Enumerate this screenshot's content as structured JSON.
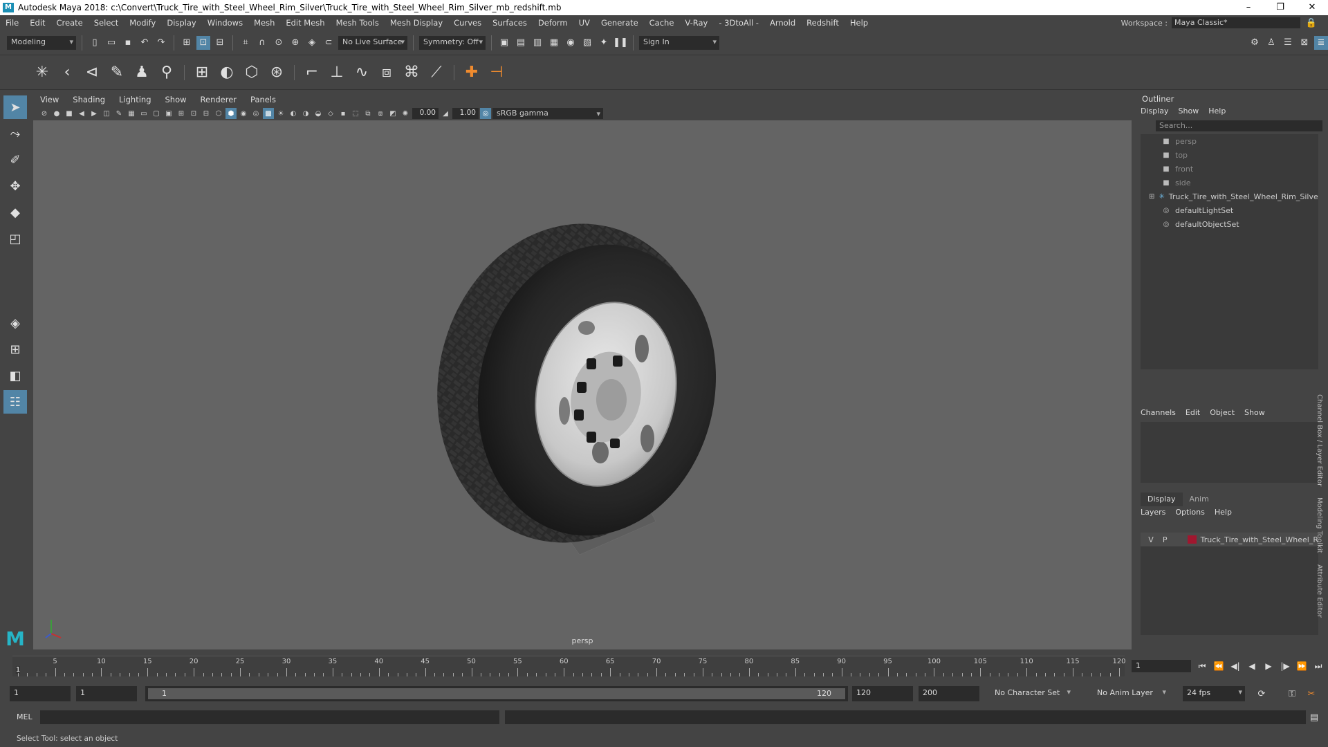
{
  "window": {
    "title": "Autodesk Maya 2018: c:\\Convert\\Truck_Tire_with_Steel_Wheel_Rim_Silver\\Truck_Tire_with_Steel_Wheel_Rim_Silver_mb_redshift.mb",
    "logo": "M",
    "minimize": "–",
    "maximize": "❐",
    "close": "✕"
  },
  "menubar": {
    "items": [
      "File",
      "Edit",
      "Create",
      "Select",
      "Modify",
      "Display",
      "Windows",
      "Mesh",
      "Edit Mesh",
      "Mesh Tools",
      "Mesh Display",
      "Curves",
      "Surfaces",
      "Deform",
      "UV",
      "Generate",
      "Cache",
      "V-Ray",
      "- 3DtoAll -",
      "Arnold",
      "Redshift",
      "Help"
    ],
    "workspace_label": "Workspace :",
    "workspace_value": "Maya Classic*"
  },
  "statusline": {
    "menuset": "Modeling",
    "live_surface": "No Live Surface",
    "symmetry": "Symmetry: Off",
    "sign_in": "Sign In"
  },
  "viewport": {
    "menu": [
      "View",
      "Shading",
      "Lighting",
      "Show",
      "Renderer",
      "Panels"
    ],
    "exposure": "0.00",
    "gamma": "1.00",
    "color_space": "sRGB gamma",
    "camera_label": "persp"
  },
  "outliner": {
    "title": "Outliner",
    "menu": [
      "Display",
      "Show",
      "Help"
    ],
    "search_placeholder": "Search...",
    "items": [
      {
        "label": "persp",
        "icon": "camera-icon",
        "dim": true
      },
      {
        "label": "top",
        "icon": "camera-icon",
        "dim": true
      },
      {
        "label": "front",
        "icon": "camera-icon",
        "dim": true
      },
      {
        "label": "side",
        "icon": "camera-icon",
        "dim": true
      },
      {
        "label": "Truck_Tire_with_Steel_Wheel_Rim_Silver_",
        "icon": "group-icon",
        "dim": false
      },
      {
        "label": "defaultLightSet",
        "icon": "set-icon",
        "dim": false
      },
      {
        "label": "defaultObjectSet",
        "icon": "set-icon",
        "dim": false
      }
    ]
  },
  "channelbox": {
    "menu": [
      "Channels",
      "Edit",
      "Object",
      "Show"
    ]
  },
  "layers": {
    "tabs": [
      "Display",
      "Anim"
    ],
    "menu": [
      "Layers",
      "Options",
      "Help"
    ],
    "row": {
      "v": "V",
      "p": "P",
      "name": "Truck_Tire_with_Steel_Wheel_R",
      "color": "#a0172f"
    }
  },
  "sidetabs": [
    "Channel Box / Layer Editor",
    "Modeling Toolkit",
    "Attribute Editor"
  ],
  "timeslider": {
    "labels": [
      "5",
      "10",
      "15",
      "20",
      "25",
      "30",
      "35",
      "40",
      "45",
      "50",
      "55",
      "60",
      "65",
      "70",
      "75",
      "80",
      "85",
      "90",
      "95",
      "100",
      "105",
      "110",
      "115",
      "120"
    ],
    "current_marker": "1",
    "current_frame": "1"
  },
  "rangeslider": {
    "start": "1",
    "playback_start": "1",
    "range_left": "1",
    "range_right": "120",
    "playback_end": "120",
    "end": "200",
    "character_set": "No Character Set",
    "anim_layer": "No Anim Layer",
    "fps": "24 fps"
  },
  "cmdline": {
    "label": "MEL"
  },
  "helpline": {
    "text": "Select Tool: select an object"
  }
}
